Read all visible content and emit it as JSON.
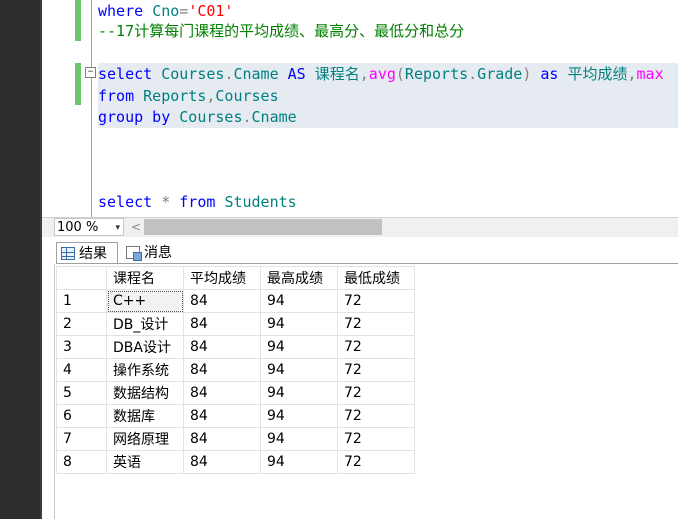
{
  "editor": {
    "lines": [
      {
        "parts": [
          [
            "kw",
            "where "
          ],
          [
            "id",
            "Cno"
          ],
          [
            "gr",
            "="
          ],
          [
            "str",
            "'C01'"
          ]
        ]
      },
      {
        "parts": [
          [
            "cm",
            "--17计算每门课程的平均成绩、最高分、最低分和总分"
          ]
        ]
      },
      {
        "parts": []
      },
      {
        "parts": [
          [
            "kw",
            "select "
          ],
          [
            "id",
            "Courses"
          ],
          [
            "gr",
            "."
          ],
          [
            "id",
            "Cname "
          ],
          [
            "kw",
            "AS "
          ],
          [
            "id",
            "课程名"
          ],
          [
            "gr",
            ","
          ],
          [
            "fn",
            "avg"
          ],
          [
            "gr",
            "("
          ],
          [
            "id",
            "Reports"
          ],
          [
            "gr",
            "."
          ],
          [
            "id",
            "Grade"
          ],
          [
            "gr",
            ") "
          ],
          [
            "kw",
            "as "
          ],
          [
            "id",
            "平均成绩"
          ],
          [
            "gr",
            ","
          ],
          [
            "fn",
            "max"
          ]
        ]
      },
      {
        "parts": [
          [
            "kw",
            "from "
          ],
          [
            "id",
            "Reports"
          ],
          [
            "gr",
            ","
          ],
          [
            "id",
            "Courses "
          ]
        ]
      },
      {
        "parts": [
          [
            "kw",
            "group by "
          ],
          [
            "id",
            "Courses"
          ],
          [
            "gr",
            "."
          ],
          [
            "id",
            "Cname"
          ]
        ]
      },
      {
        "parts": []
      },
      {
        "parts": []
      },
      {
        "parts": [
          [
            "kw",
            "select "
          ],
          [
            "gr",
            "* "
          ],
          [
            "kw",
            "from "
          ],
          [
            "id",
            "Students"
          ]
        ]
      }
    ]
  },
  "statusbar": {
    "zoom_label": "100 %",
    "zoom_arrow": "▾",
    "scroll_left": "<"
  },
  "results": {
    "tabs": [
      {
        "label": "结果",
        "icon": "grid-icon",
        "active": true
      },
      {
        "label": "消息",
        "icon": "message-icon",
        "active": false
      }
    ],
    "columns": [
      "",
      "课程名",
      "平均成绩",
      "最高成绩",
      "最低成绩"
    ],
    "rows": [
      [
        "1",
        "C++",
        "84",
        "94",
        "72"
      ],
      [
        "2",
        "DB_设计",
        "84",
        "94",
        "72"
      ],
      [
        "3",
        "DBA设计",
        "84",
        "94",
        "72"
      ],
      [
        "4",
        "操作系统",
        "84",
        "94",
        "72"
      ],
      [
        "5",
        "数据结构",
        "84",
        "94",
        "72"
      ],
      [
        "6",
        "数据库",
        "84",
        "94",
        "72"
      ],
      [
        "7",
        "网络原理",
        "84",
        "94",
        "72"
      ],
      [
        "8",
        "英语",
        "84",
        "94",
        "72"
      ]
    ]
  },
  "colors": {
    "change_bar": "#6ec76e",
    "keyword": "#0000ff",
    "function": "#ff00ff",
    "string": "#ff0000",
    "comment": "#008000",
    "highlight": "#e5ebf1"
  }
}
